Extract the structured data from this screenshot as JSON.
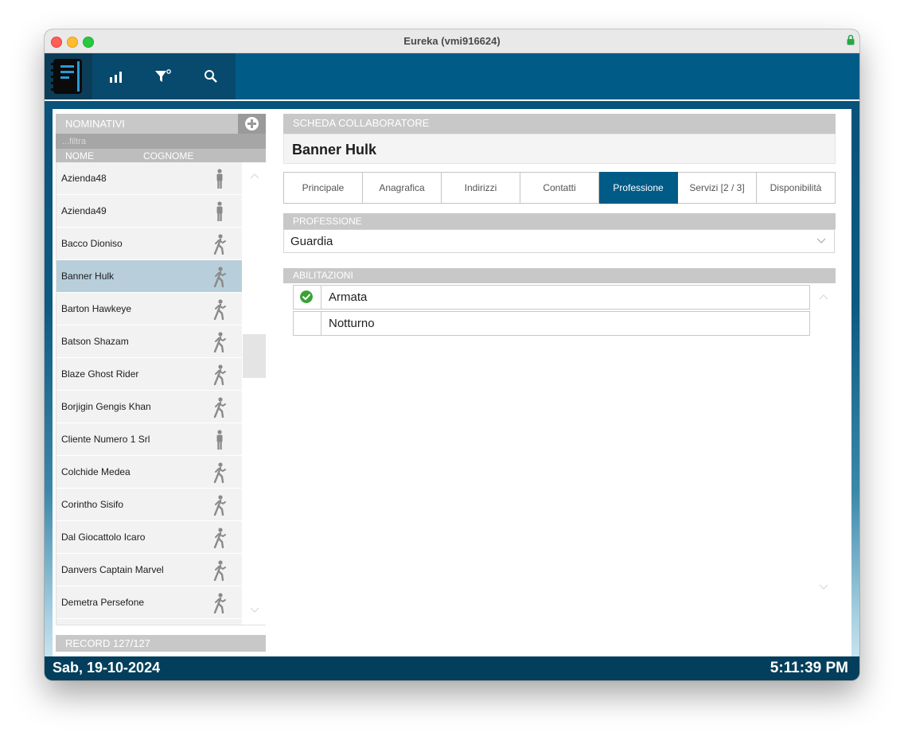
{
  "window": {
    "title": "Eureka (vmi916624)"
  },
  "toolbar": {
    "icons": [
      "notebook-logo-icon",
      "bar-chart-icon",
      "filter-icon",
      "search-icon"
    ]
  },
  "left_panel": {
    "title": "NOMINATIVI",
    "filter_placeholder": "...filtra",
    "columns": [
      "NOME",
      "COGNOME"
    ],
    "rows": [
      {
        "name": "Azienda48",
        "type": "person-standing-icon"
      },
      {
        "name": "Azienda49",
        "type": "person-standing-icon"
      },
      {
        "name": "Bacco Dioniso",
        "type": "person-walking-icon"
      },
      {
        "name": "Banner Hulk",
        "type": "person-walking-icon",
        "selected": true
      },
      {
        "name": "Barton Hawkeye",
        "type": "person-walking-icon"
      },
      {
        "name": "Batson Shazam",
        "type": "person-walking-icon"
      },
      {
        "name": "Blaze Ghost Rider",
        "type": "person-walking-icon"
      },
      {
        "name": "Borjigin Gengis Khan",
        "type": "person-walking-icon"
      },
      {
        "name": "Cliente Numero 1 Srl",
        "type": "person-standing-icon"
      },
      {
        "name": "Colchide Medea",
        "type": "person-walking-icon"
      },
      {
        "name": "Corintho Sisifo",
        "type": "person-walking-icon"
      },
      {
        "name": "Dal Giocattolo Icaro",
        "type": "person-walking-icon"
      },
      {
        "name": "Danvers Captain Marvel",
        "type": "person-walking-icon"
      },
      {
        "name": "Demetra Persefone",
        "type": "person-walking-icon"
      }
    ],
    "record_label": "RECORD 127/127"
  },
  "right_panel": {
    "section_title": "SCHEDA COLLABORATORE",
    "person_name": "Banner Hulk",
    "tabs": [
      "Principale",
      "Anagrafica",
      "Indirizzi",
      "Contatti",
      "Professione",
      "Servizi [2 / 3]",
      "Disponibilità"
    ],
    "active_tab": "Professione",
    "profession": {
      "label": "PROFESSIONE",
      "value": "Guardia"
    },
    "abilitazioni": {
      "label": "ABILITAZIONI",
      "items": [
        {
          "label": "Armata",
          "checked": true
        },
        {
          "label": "Notturno",
          "checked": false
        }
      ]
    }
  },
  "status": {
    "date": "Sab, 19-10-2024",
    "time": "5:11:39 PM"
  },
  "colors": {
    "accent": "#005b87",
    "selected_row": "#b8cfdb",
    "check_green": "#3aa236"
  }
}
